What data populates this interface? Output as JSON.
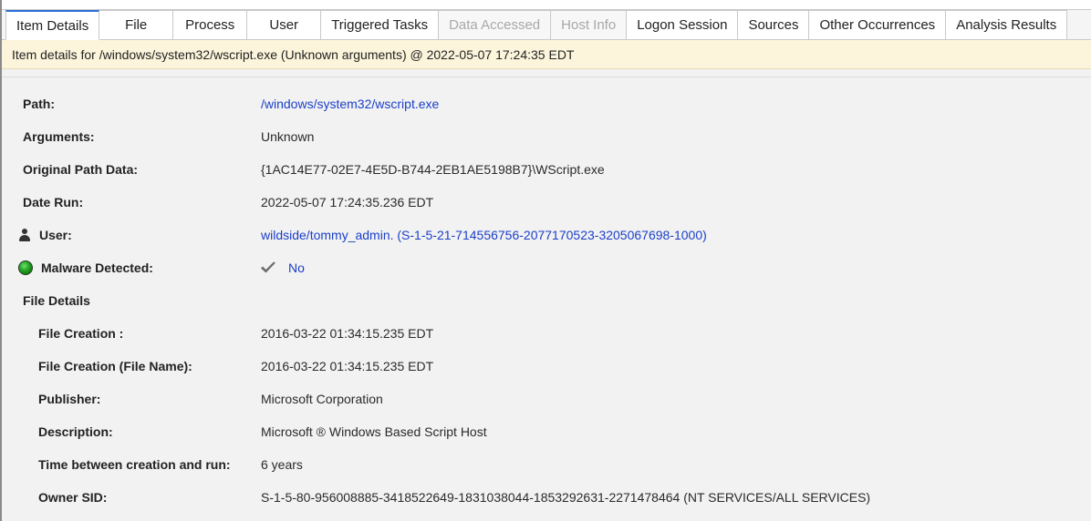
{
  "tabs": [
    {
      "label": "Item Details",
      "state": "active"
    },
    {
      "label": "File",
      "state": "normal"
    },
    {
      "label": "Process",
      "state": "normal"
    },
    {
      "label": "User",
      "state": "normal"
    },
    {
      "label": "Triggered Tasks",
      "state": "normal"
    },
    {
      "label": "Data Accessed",
      "state": "disabled"
    },
    {
      "label": "Host Info",
      "state": "disabled"
    },
    {
      "label": "Logon Session",
      "state": "normal"
    },
    {
      "label": "Sources",
      "state": "normal"
    },
    {
      "label": "Other Occurrences",
      "state": "normal"
    },
    {
      "label": "Analysis Results",
      "state": "normal"
    }
  ],
  "banner": {
    "text": "Item details for /windows/system32/wscript.exe (Unknown arguments) @ 2022-05-07 17:24:35 EDT"
  },
  "details": {
    "path": {
      "label": "Path:",
      "value": "/windows/system32/wscript.exe"
    },
    "arguments": {
      "label": "Arguments:",
      "value": "Unknown"
    },
    "original_path_data": {
      "label": "Original Path Data:",
      "value": "{1AC14E77-02E7-4E5D-B744-2EB1AE5198B7}\\WScript.exe"
    },
    "date_run": {
      "label": "Date Run:",
      "value": "2022-05-07 17:24:35.236 EDT"
    },
    "user": {
      "label": "User:",
      "value": "wildside/tommy_admin. (S-1-5-21-714556756-2077170523-3205067698-1000)",
      "icon": "user-icon"
    },
    "malware": {
      "label": "Malware Detected:",
      "value": "No",
      "icon": "malware-status-icon",
      "check_icon": "checkmark-icon"
    },
    "file_details": {
      "label": "File Details"
    },
    "file_creation": {
      "label": "File Creation :",
      "value": "2016-03-22 01:34:15.235 EDT"
    },
    "file_creation_name": {
      "label": "File Creation (File Name):",
      "value": "2016-03-22 01:34:15.235 EDT"
    },
    "publisher": {
      "label": "Publisher:",
      "value": "Microsoft Corporation"
    },
    "description": {
      "label": "Description:",
      "value": "Microsoft ® Windows Based Script Host"
    },
    "time_between": {
      "label": "Time between creation and run:",
      "value": "6 years"
    },
    "owner_sid": {
      "label": "Owner SID:",
      "value": "S-1-5-80-956008885-3418522649-1831038044-1853292631-2271478464 (NT SERVICES/ALL SERVICES)"
    }
  },
  "colors": {
    "link": "#1a3fc8",
    "banner_bg": "#fcf5dc",
    "active_tab_accent": "#2a6fd6",
    "disabled_tab_text": "#a8a8a8"
  }
}
